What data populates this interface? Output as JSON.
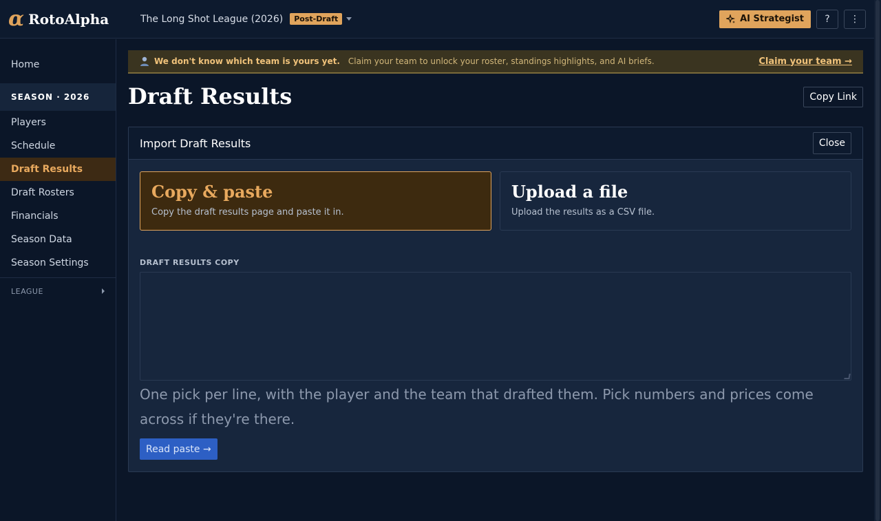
{
  "app": {
    "logo_mark": "α",
    "name": "RotoAlpha"
  },
  "header": {
    "league_name": "The Long Shot League (2026)",
    "league_status": "Post-Draft",
    "ai_button_label": "AI Strategist",
    "help_label": "?",
    "more_label": "⋮"
  },
  "sidebar": {
    "home": "Home",
    "season_section": "SEASON · 2026",
    "items": [
      {
        "label": "Players"
      },
      {
        "label": "Schedule"
      },
      {
        "label": "Draft Results"
      },
      {
        "label": "Draft Rosters"
      },
      {
        "label": "Financials"
      },
      {
        "label": "Season Data"
      },
      {
        "label": "Season Settings"
      }
    ],
    "active_item": "Draft Results",
    "league_section": "LEAGUE"
  },
  "banner": {
    "icon": "user-icon",
    "strong_text": "We don't know which team is yours yet.",
    "text": "Claim your team to unlock your roster, standings highlights, and AI briefs.",
    "link": "Claim your team →"
  },
  "page": {
    "title": "Draft Results",
    "copy_link_label": "Copy Link"
  },
  "import_panel": {
    "title": "Import Draft Results",
    "close_label": "Close",
    "options": [
      {
        "title": "Copy & paste",
        "description": "Copy the draft results page and paste it in.",
        "selected": true
      },
      {
        "title": "Upload a file",
        "description": "Upload the results as a CSV file.",
        "selected": false
      }
    ],
    "field_label": "DRAFT RESULTS COPY",
    "textarea_value": "",
    "textarea_placeholder": "",
    "help_text": "One pick per line, with the player and the team that drafted them. Pick numbers and prices come across if they're there.",
    "read_button_label": "Read paste →"
  },
  "colors": {
    "accent": "#e0a45c",
    "background": "#0b1628",
    "panel": "#17263d",
    "primary_button": "#2d5fc4"
  }
}
